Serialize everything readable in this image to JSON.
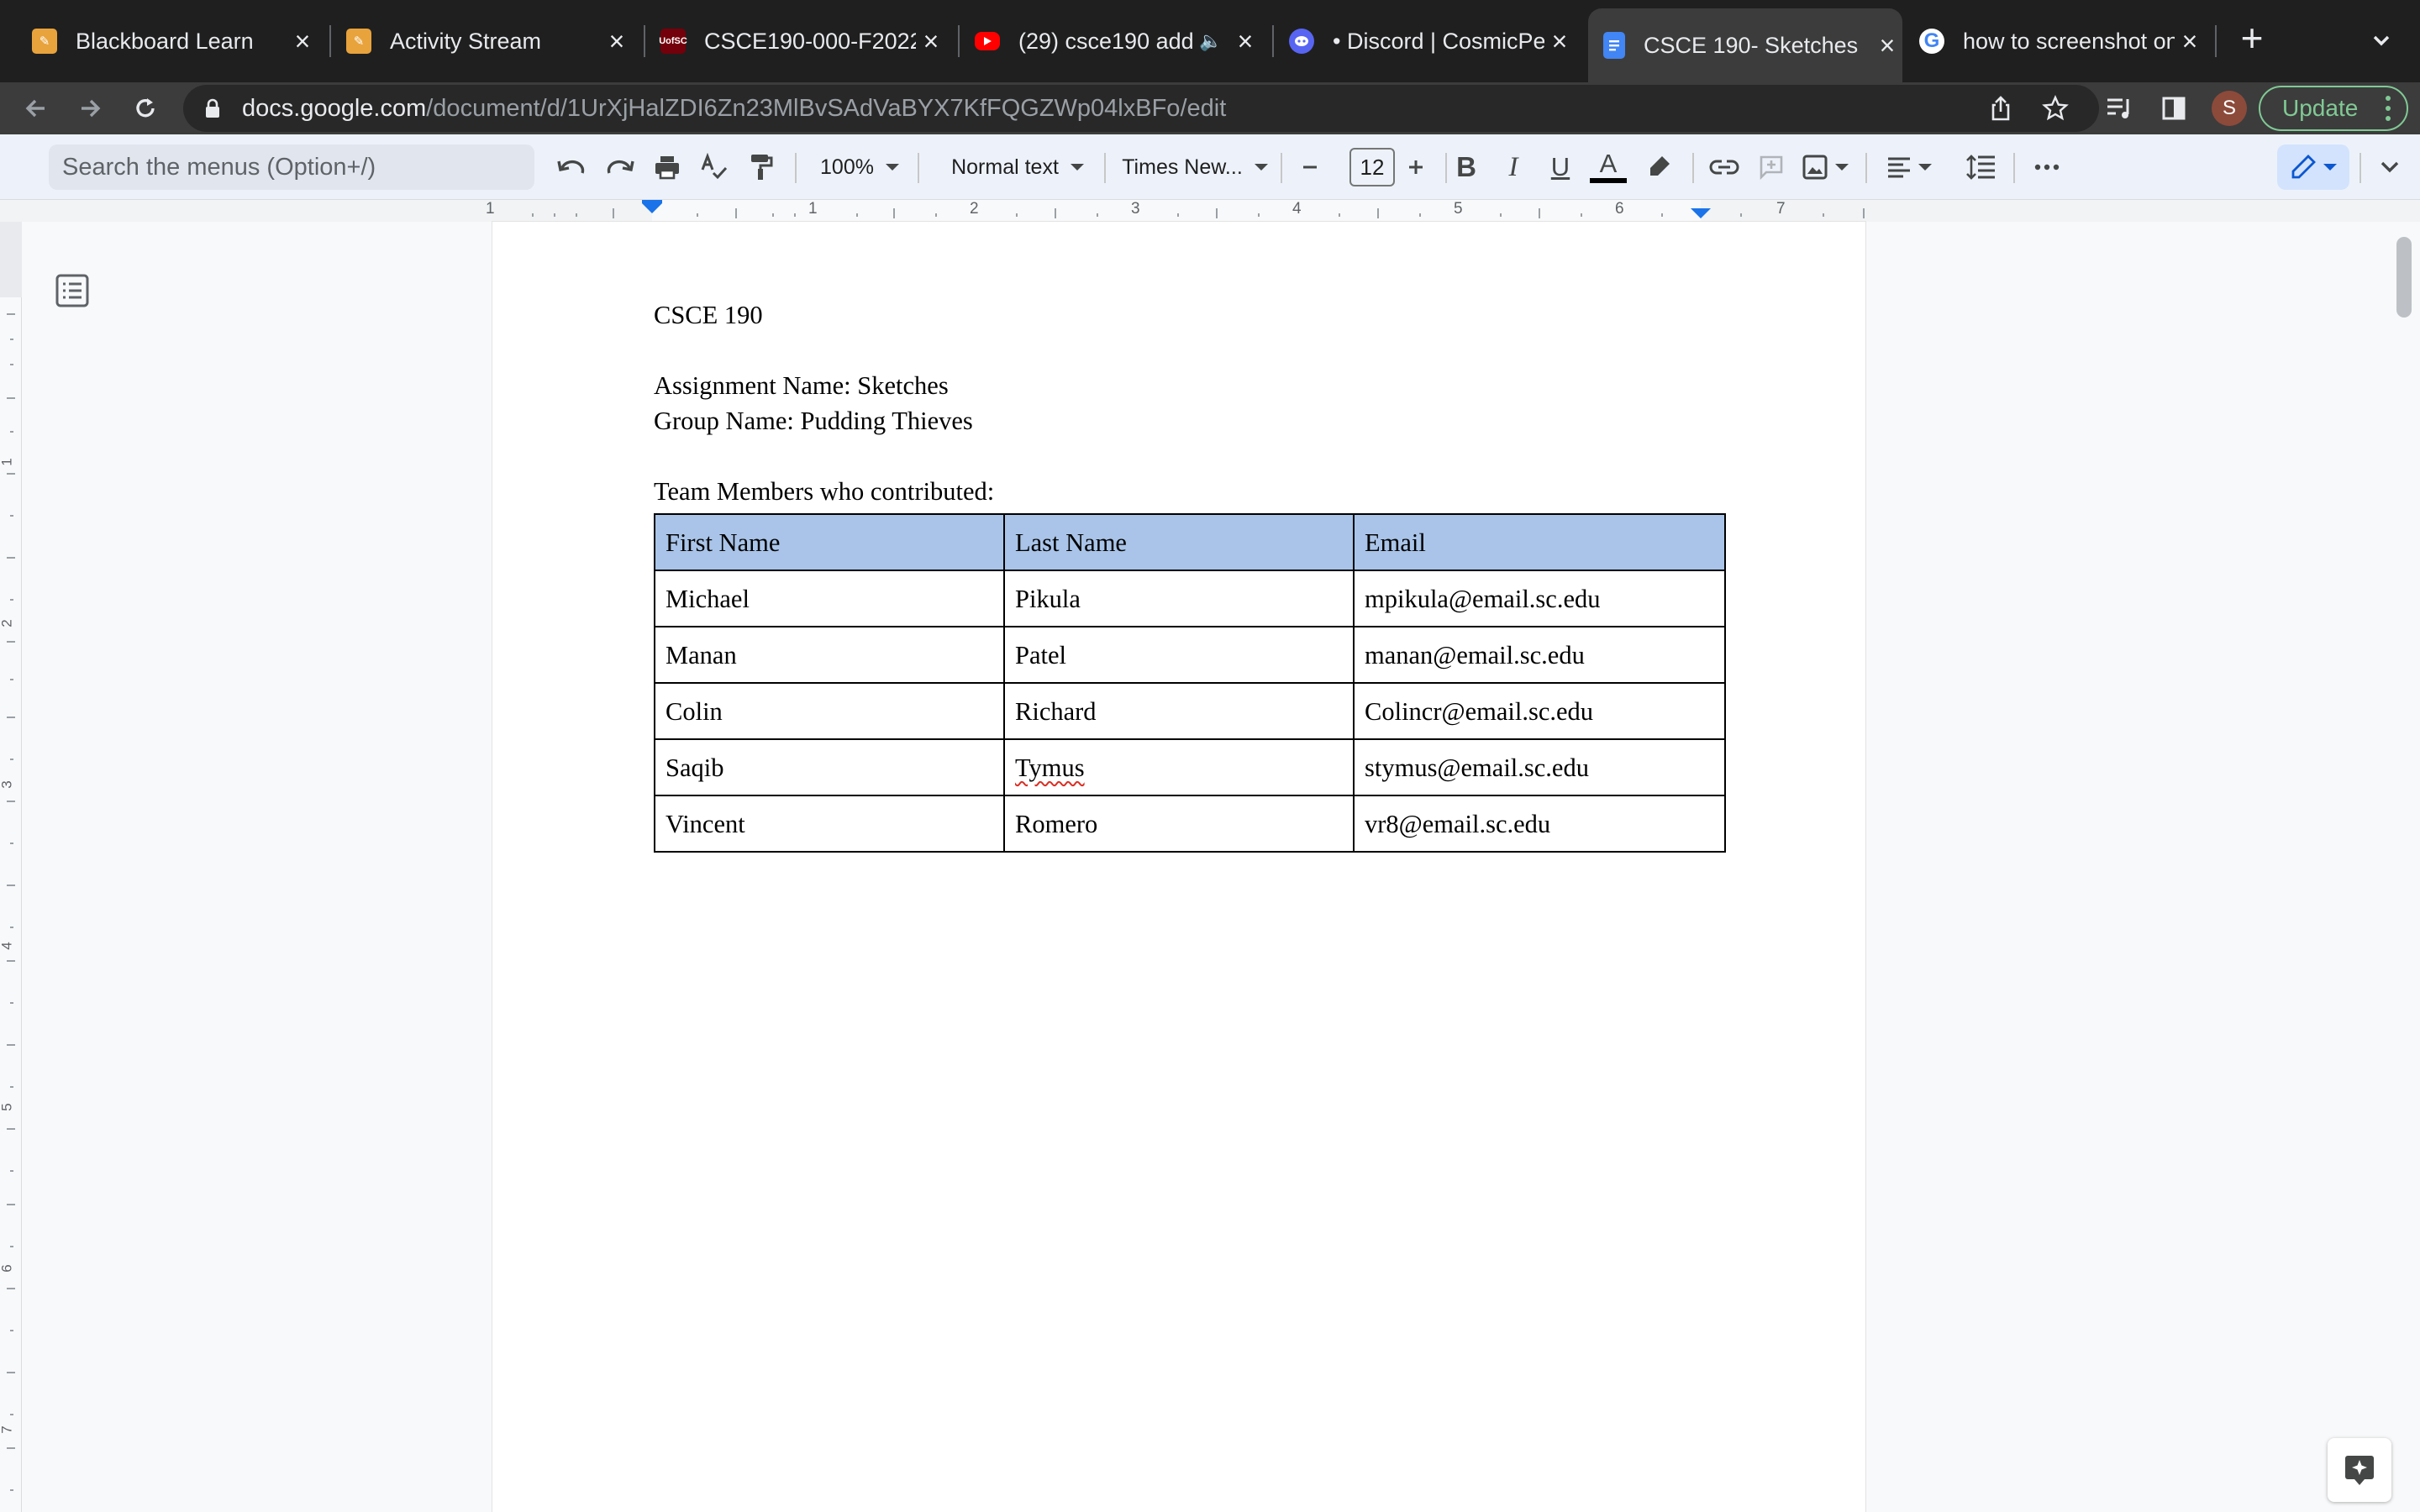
{
  "browser": {
    "tabs": [
      {
        "title": "Blackboard Learn",
        "icon": "pencil-favicon",
        "color": "#e8a33d"
      },
      {
        "title": "Activity Stream",
        "icon": "pencil-favicon",
        "color": "#e8a33d"
      },
      {
        "title": "CSCE190-000-F2022",
        "icon": "usc-favicon",
        "color": "#73000a",
        "icon_text": "UofSC"
      },
      {
        "title": "(29) csce190 add",
        "icon": "youtube-favicon",
        "color": "#ff0000"
      },
      {
        "title": "• Discord | CosmicPe",
        "icon": "discord-favicon",
        "color": "#5865f2"
      },
      {
        "title": "CSCE 190- Sketches",
        "icon": "google-docs-favicon",
        "color": "#4285f4"
      },
      {
        "title": "how to screenshot on",
        "icon": "google-favicon",
        "color": "#4285f4"
      }
    ],
    "address": {
      "host": "docs.google.com",
      "path": "/document/d/1UrXjHalZDI6Zn23MlBvSAdVaBYX7KfFQGZWp04lxBFo/edit"
    },
    "profile_initial": "S",
    "update_label": "Update"
  },
  "toolbar": {
    "menu_search_placeholder": "Search the menus (Option+/)",
    "zoom": "100%",
    "style": "Normal text",
    "font": "Times New...",
    "font_size": "12"
  },
  "ruler": {
    "h_labels": [
      "1",
      "1",
      "2",
      "3",
      "4",
      "5",
      "6",
      "7"
    ],
    "v_labels": [
      "1",
      "2",
      "3",
      "4",
      "5",
      "6",
      "7"
    ]
  },
  "document": {
    "course": "CSCE 190",
    "assignment": "Assignment Name: Sketches",
    "group": "Group Name: Pudding Thieves",
    "team_heading": "Team Members who contributed:",
    "table": {
      "headers": [
        "First Name",
        "Last Name",
        "Email"
      ],
      "rows": [
        [
          "Michael",
          "Pikula",
          "mpikula@email.sc.edu"
        ],
        [
          "Manan",
          "Patel",
          "manan@email.sc.edu"
        ],
        [
          "Colin",
          "Richard",
          "Colincr@email.sc.edu"
        ],
        [
          "Saqib",
          "Tymus",
          "stymus@email.sc.edu"
        ],
        [
          "Vincent",
          "Romero",
          "vr8@email.sc.edu"
        ]
      ],
      "header_color": "#a9c4e8"
    }
  },
  "colors": {
    "accent_blue": "#1a73e8",
    "update_green": "#81c995"
  }
}
